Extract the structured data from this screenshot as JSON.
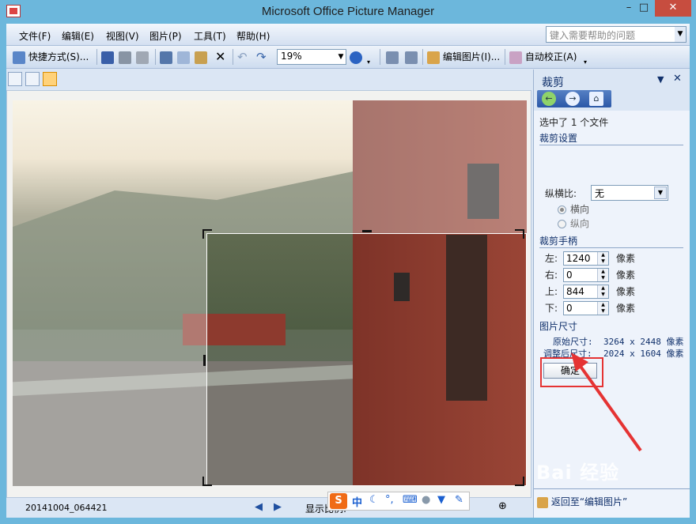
{
  "window": {
    "title": "Microsoft Office Picture Manager",
    "min_glyph": "–",
    "max_glyph": "□",
    "close_glyph": "✕"
  },
  "menu": {
    "items": [
      "文件(F)",
      "编辑(E)",
      "视图(V)",
      "图片(P)",
      "工具(T)",
      "帮助(H)"
    ],
    "help_placeholder": "键入需要帮助的问题"
  },
  "toolbar": {
    "shortcut_label": "快捷方式(S)...",
    "zoom_value": "19%",
    "edit_picture_label": "编辑图片(I)...",
    "auto_correct_label": "自动校正(A)"
  },
  "status": {
    "filename": "20141004_064421",
    "zoom_label": "显示比例:"
  },
  "ime": {
    "mode_label": "中"
  },
  "task_pane": {
    "title": "裁剪",
    "selection_info": "选中了 1 个文件",
    "crop_settings_heading": "裁剪设置",
    "aspect_label": "纵横比:",
    "aspect_value": "无",
    "orientation_landscape": "横向",
    "orientation_portrait": "纵向",
    "crop_handles_heading": "裁剪手柄",
    "handles": [
      {
        "label": "左:",
        "value": "1240",
        "unit": "像素"
      },
      {
        "label": "右:",
        "value": "0",
        "unit": "像素"
      },
      {
        "label": "上:",
        "value": "844",
        "unit": "像素"
      },
      {
        "label": "下:",
        "value": "0",
        "unit": "像素"
      }
    ],
    "picture_size_heading": "图片尺寸",
    "original_size_label": "原始尺寸:",
    "original_size_value": "3264 x 2448 像素",
    "adjusted_size_label": "调整后尺寸:",
    "adjusted_size_value": "2024 x 1604 像素",
    "ok_label": "确定",
    "back_link": "返回至“编辑图片”"
  },
  "watermark": "Bai 经验",
  "colors": {
    "frame": "#6cb7dc",
    "close_button": "#c74d3f",
    "annotation_red": "#e53333",
    "wall_red": "#8a3a30"
  }
}
